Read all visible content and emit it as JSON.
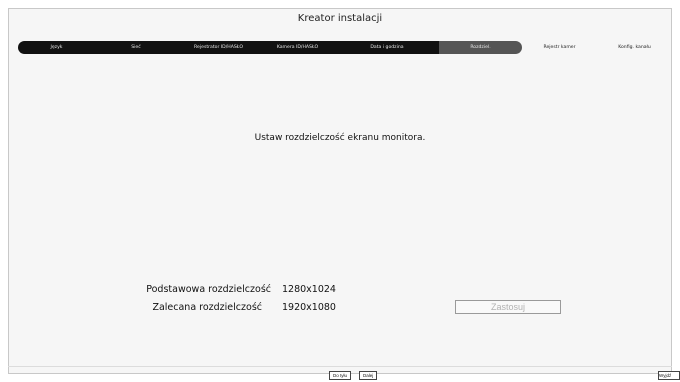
{
  "window": {
    "title": "Kreator instalacji"
  },
  "steps": [
    {
      "label": "Język",
      "state": "done"
    },
    {
      "label": "Sieć",
      "state": "done"
    },
    {
      "label": "Rejestrator ID/HASŁO",
      "state": "done"
    },
    {
      "label": "Kamera ID/HASŁO",
      "state": "done"
    },
    {
      "label": "Data i godzina",
      "state": "done"
    },
    {
      "label": "Rozdziel.",
      "state": "active"
    },
    {
      "label": "Rejestr kamer",
      "state": "upcoming"
    },
    {
      "label": "Konfig. kanału",
      "state": "upcoming"
    }
  ],
  "main": {
    "headline": "Ustaw rozdzielczość ekranu monitora.",
    "basic": {
      "label": "Podstawowa rozdzielczość",
      "value": "1280x1024"
    },
    "recommended": {
      "label": "Zalecana rozdzielczość",
      "value": "1920x1080"
    },
    "apply_label": "Zastosuj"
  },
  "footer": {
    "back_label": "Do tyłu",
    "next_label": "Dalej",
    "exit_label": "Wyjdź"
  },
  "colors": {
    "step_done_bg": "#111111",
    "step_active_bg": "#555555",
    "background": "#f6f6f6"
  }
}
